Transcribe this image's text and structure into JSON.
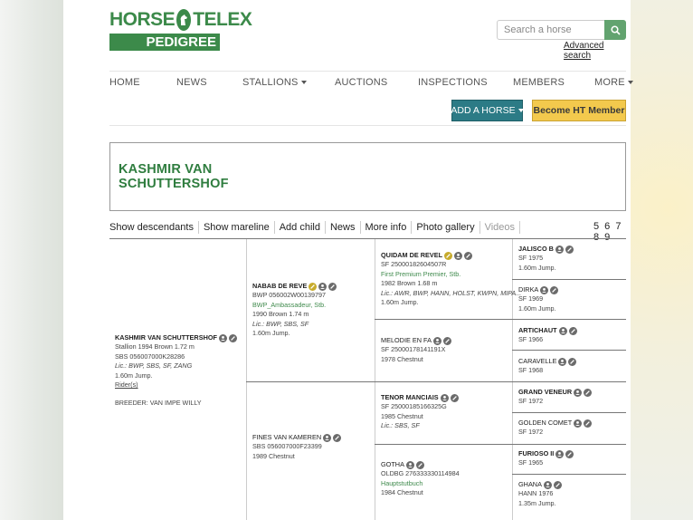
{
  "logo": {
    "top": "HORSE",
    "top2": "TELEX",
    "bottom": "PEDIGREE"
  },
  "search": {
    "placeholder": "Search a horse",
    "advanced": "Advanced search"
  },
  "nav": {
    "home": "HOME",
    "news": "NEWS",
    "stallions": "STALLIONS",
    "auctions": "AUCTIONS",
    "inspections": "INSPECTIONS",
    "members": "MEMBERS",
    "more": "MORE"
  },
  "buttons": {
    "add_horse": "ADD A HORSE",
    "become_member": "Become HT Member"
  },
  "title": "KASHMIR VAN SCHUTTERSHOF",
  "tabs": [
    "Show descendants",
    "Show mareline",
    "Add child",
    "News",
    "More info",
    "Photo gallery",
    "Videos"
  ],
  "generations": "5 6 7 8 9",
  "pedigree": {
    "subject": {
      "name": "KASHMIR VAN SCHUTTERSHOF",
      "l1": "Stallion 1994 Brown 1.72 m",
      "l2": "SBS 056007000K28286",
      "l3": "Lic.: BWP, SBS, SF, ZANG",
      "l4": "1.60m Jump.",
      "l5": "Rider(s)",
      "breeder": "BREEDER: VAN IMPE WILLY"
    },
    "sire": {
      "name": "NABAB DE REVE",
      "l1": "BWP 056002W00139797",
      "l2": "BWP_Ambassadeur, Stb.",
      "l3": "1990 Brown 1.74 m",
      "l4": "Lic.: BWP, SBS, SF",
      "l5": "1.60m Jump."
    },
    "dam": {
      "name": "FINES VAN KAMEREN",
      "l1": "SBS 056007000F23399",
      "l2": "1989 Chestnut"
    },
    "ss": {
      "name": "QUIDAM DE REVEL",
      "l1": "SF 25000182604507R",
      "l2": "First Premium Premier, Stb.",
      "l3": "1982 Brown 1.68 m",
      "l4": "Lic.: AWR, BWP, HANN, HOLST, KWPN, MIPA...",
      "l5": "1.60m Jump."
    },
    "sd": {
      "name": "MELODIE EN FA",
      "l1": "SF 25000178141191X",
      "l2": "1978 Chestnut"
    },
    "ds": {
      "name": "TENOR MANCIAIS",
      "l1": "SF 25000185166325G",
      "l2": "1985 Chestnut",
      "l3": "Lic.: SBS, SF"
    },
    "dd": {
      "name": "GOTHA",
      "l1": "OLDBG 276333330114984",
      "l2": "Hauptstutbuch",
      "l3": "1984 Chestnut"
    },
    "g3": [
      {
        "name": "JALISCO B",
        "l1": "SF 1975",
        "l2": "1.60m Jump."
      },
      {
        "name": "DIRKA",
        "l1": "SF 1969",
        "l2": "1.60m Jump."
      },
      {
        "name": "ARTICHAUT",
        "l1": "SF 1966"
      },
      {
        "name": "CARAVELLE",
        "l1": "SF 1968"
      },
      {
        "name": "GRAND VENEUR",
        "l1": "SF 1972"
      },
      {
        "name": "GOLDEN COMET",
        "l1": "SF 1972"
      },
      {
        "name": "FURIOSO II",
        "l1": "SF 1965"
      },
      {
        "name": "GHANA",
        "l1": "HANN 1976",
        "l2": "1.35m Jump."
      }
    ]
  },
  "colors": {
    "brand_green": "#3c8a4a",
    "add_button": "#2c7b86",
    "member_button": "#f3c94d"
  },
  "icons": [
    "search-icon",
    "horse-logo-icon",
    "photo-icon",
    "pencil-icon",
    "star-icon"
  ]
}
